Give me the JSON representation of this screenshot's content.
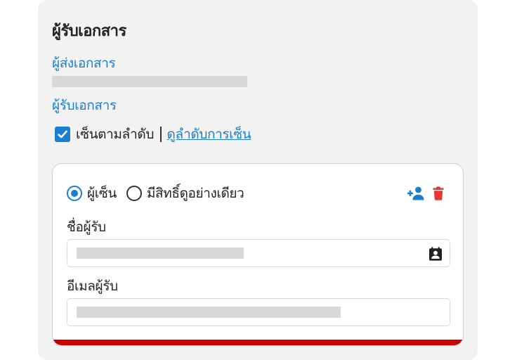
{
  "panel": {
    "title": "ผู้รับเอกสาร",
    "sender_link": "ผู้ส่งเอกสาร",
    "receiver_link": "ผู้รับเอกสาร"
  },
  "signing_order": {
    "checked": true,
    "label": "เซ็นตามลำดับ",
    "divider": "|",
    "view_link": "ดูลำดับการเซ็น"
  },
  "recipient_card": {
    "role_options": [
      {
        "label": "ผู้เซ็น",
        "selected": true
      },
      {
        "label": "มีสิทธิ์ดูอย่างเดียว",
        "selected": false
      }
    ],
    "actions": {
      "add_person_icon": "person-add-icon",
      "delete_icon": "trash-icon"
    },
    "name_label": "ชื่อผู้รับ",
    "email_label": "อีเมลผู้รับ",
    "contact_icon": "contact-book-icon"
  },
  "colors": {
    "accent": "#1a7fd0",
    "danger": "#e53935",
    "bottom_bar": "#cc0000",
    "panel_bg": "#f2f2f2",
    "placeholder": "#d7d7d7"
  }
}
